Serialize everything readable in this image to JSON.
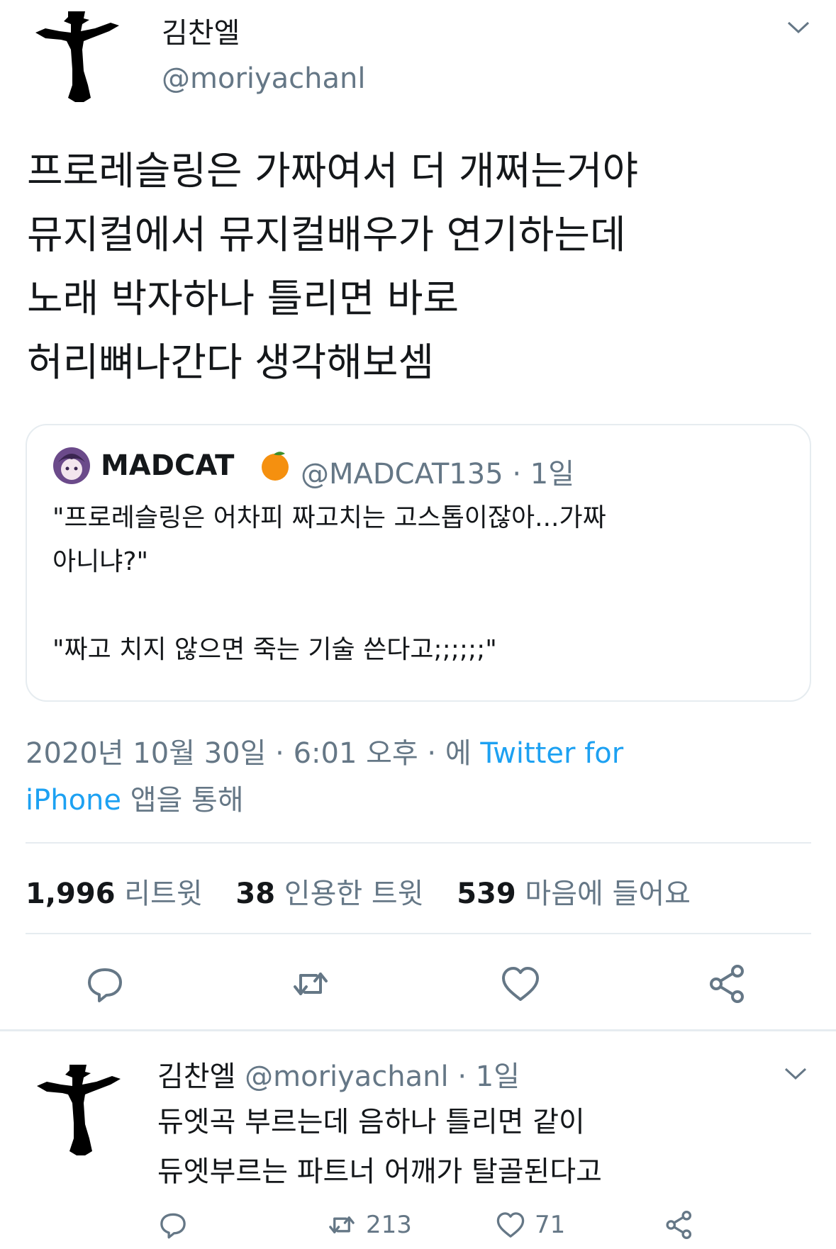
{
  "main_tweet": {
    "name": "김찬엘",
    "handle": "@moriyachanl",
    "body_lines": [
      "프로레슬링은 가짜여서 더 개쩌는거야",
      "뮤지컬에서 뮤지컬배우가 연기하는데",
      "노래 박자하나 틀리면 바로",
      "허리뼈나간다 생각해보셈"
    ],
    "quote": {
      "name": "MADCAT",
      "emoji": "orange-emoji",
      "handle_time": "@MADCAT135 · 1일",
      "line1": "\"프로레슬링은 어차피 짜고치는 고스톱이잖아...가짜",
      "line2": "아니냐?\"",
      "line3": "\"짜고 치지 않으면 죽는 기술 쓴다고;;;;;;\""
    },
    "meta_line1": "2020년 10월 30일 · 6:01 오후 · 에 ",
    "meta_link1": "Twitter for",
    "meta_link2": "iPhone",
    "meta_line2": " 앱을 통해",
    "stats": {
      "retweets_count": "1,996",
      "retweets_label": "리트윗",
      "quotes_count": "38",
      "quotes_label": "인용한 트윗",
      "likes_count": "539",
      "likes_label": "마음에 들어요"
    },
    "actions": [
      "reply-icon",
      "retweet-icon",
      "like-icon",
      "share-icon"
    ]
  },
  "reply_tweet": {
    "name": "김찬엘",
    "handle_time": "@moriyachanl · 1일",
    "body_lines": [
      "듀엣곡 부르는데 음하나 틀리면 같이",
      "듀엣부르는 파트너 어깨가 탈골된다고"
    ],
    "retweet_count": "213",
    "like_count": "71"
  },
  "colors": {
    "text": "#14171a",
    "secondary": "#657786",
    "link": "#1da1f2",
    "divider": "#e6ecf0"
  }
}
